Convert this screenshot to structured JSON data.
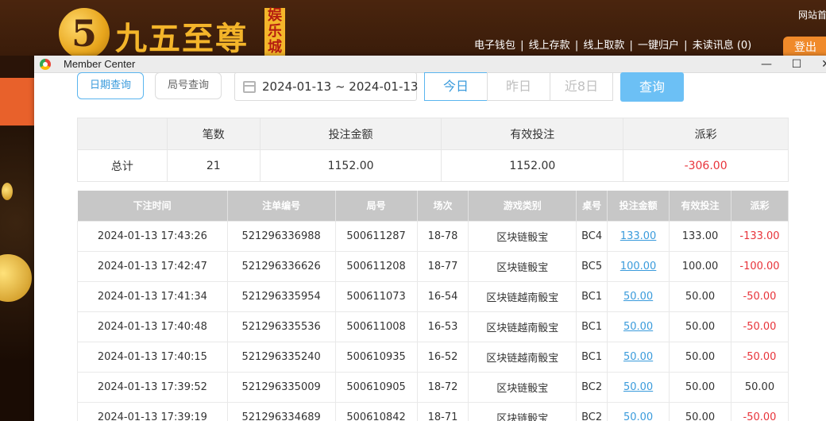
{
  "site": {
    "logo_mark": "5",
    "logo_text": "九五至尊",
    "logo_badge": "娱乐城",
    "nav": [
      "电子钱包",
      "线上存款",
      "线上取款",
      "一键归户",
      "未读讯息 (0)"
    ],
    "corner_text": "网站首",
    "logout_label": "登出"
  },
  "window": {
    "title": "Member Center",
    "minimize": "—",
    "maximize": "☐",
    "close": "✕"
  },
  "filters": {
    "tab_date": "日期查询",
    "tab_round": "局号查询",
    "date_range": "2024-01-13 ~ 2024-01-13",
    "today": "今日",
    "yesterday": "昨日",
    "last8": "近8日",
    "query": "查询"
  },
  "summary": {
    "headers": [
      "",
      "笔数",
      "投注金额",
      "有效投注",
      "派彩"
    ],
    "row": [
      "总计",
      "21",
      "1152.00",
      "1152.00",
      "-306.00"
    ]
  },
  "detail": {
    "headers": [
      "下注时间",
      "注单编号",
      "局号",
      "场次",
      "游戏类别",
      "桌号",
      "投注金额",
      "有效投注",
      "派彩"
    ],
    "rows": [
      [
        "2024-01-13 17:43:26",
        "521296336988",
        "500611287",
        "18-78",
        "区块链骰宝",
        "BC4",
        "133.00",
        "133.00",
        "-133.00"
      ],
      [
        "2024-01-13 17:42:47",
        "521296336626",
        "500611208",
        "18-77",
        "区块链骰宝",
        "BC5",
        "100.00",
        "100.00",
        "-100.00"
      ],
      [
        "2024-01-13 17:41:34",
        "521296335954",
        "500611073",
        "16-54",
        "区块链越南骰宝",
        "BC1",
        "50.00",
        "50.00",
        "-50.00"
      ],
      [
        "2024-01-13 17:40:48",
        "521296335536",
        "500611008",
        "16-53",
        "区块链越南骰宝",
        "BC1",
        "50.00",
        "50.00",
        "-50.00"
      ],
      [
        "2024-01-13 17:40:15",
        "521296335240",
        "500610935",
        "16-52",
        "区块链越南骰宝",
        "BC1",
        "50.00",
        "50.00",
        "-50.00"
      ],
      [
        "2024-01-13 17:39:52",
        "521296335009",
        "500610905",
        "18-72",
        "区块链骰宝",
        "BC2",
        "50.00",
        "50.00",
        "50.00"
      ],
      [
        "2024-01-13 17:39:19",
        "521296334689",
        "500610842",
        "18-71",
        "区块链骰宝",
        "BC2",
        "50.00",
        "50.00",
        "-50.00"
      ]
    ]
  },
  "colors": {
    "accent": "#3a9bdc",
    "negative": "#e8333a",
    "header_gray": "#c7c7c7"
  }
}
